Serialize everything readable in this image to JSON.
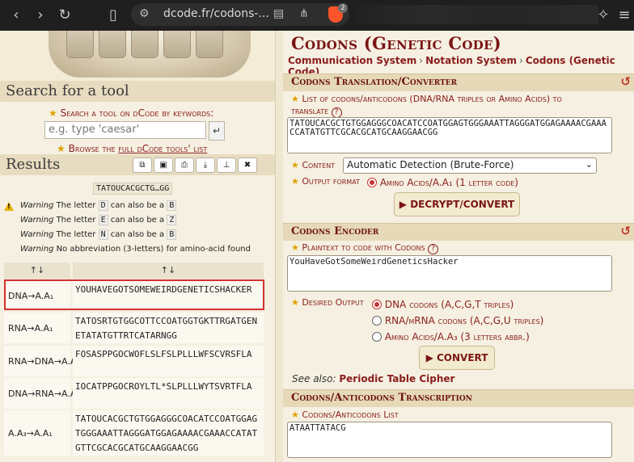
{
  "browser": {
    "url": "dcode.fr/codons-...",
    "brave_badge": "2"
  },
  "left": {
    "search_heading": "Search for a tool",
    "search_label": "Search a tool on dCode by keywords:",
    "search_placeholder": "e.g. type 'caesar'",
    "browse_prefix": "Browse the ",
    "browse_link": "full dCode tools' list",
    "results_title": "Results",
    "input_tag": "TATOUCACGCTG…GG",
    "warnings": [
      {
        "pre": "Warning",
        "text1": " The letter ",
        "key": "D",
        "text2": " can also be a ",
        "key2": "B"
      },
      {
        "pre": "Warning",
        "text1": " The letter ",
        "key": "E",
        "text2": " can also be a ",
        "key2": "Z"
      },
      {
        "pre": "Warning",
        "text1": " The letter ",
        "key": "N",
        "text2": " can also be a ",
        "key2": "B"
      },
      {
        "pre": "Warning",
        "text1": " No abbreviation (3-letters) for amino-acid found",
        "key": "",
        "text2": "",
        "key2": ""
      }
    ],
    "table": {
      "sort_col1": "↑↓",
      "sort_col2": "↑↓",
      "rows": [
        {
          "key": "DNA→A.A₁",
          "value": "YOUHAVEGOTSOMEWEIRDGENETICSHACKER"
        },
        {
          "key": "RNA→A.A₁",
          "value": "TATOSRTGTGGCOTTCCOATGGTGKTTRGATGENETATATGTTRTCATARNGG"
        },
        {
          "key": "RNA→DNA→A.A₁",
          "value": "FOSASPPGOCWOFLSLFSLPLLLWFSCVRSFLA"
        },
        {
          "key": "DNA→RNA→A.A₁",
          "value": "IOCATPPGOCROYLTL*SLPLLLWYTSVRTFLA"
        },
        {
          "key": "A.A₃→A.A₁",
          "value": "TATOUCACGCTGTGGAGGGCOACATCCOATGGAGTGGGAAATTAGGGATGGAGAAAACGAAACCATATGTTCGCACGCATGCAAGGAACGG"
        }
      ]
    }
  },
  "right": {
    "page_title": "Codons (Genetic Code)",
    "breadcrumbs": [
      "Communication System",
      "Notation System",
      "Codons (Genetic Code)"
    ],
    "translator": {
      "title": "Codons Translation/Converter",
      "list_label": "List of codons/anticodons (DNA/RNA triples or Amino Acids) to translate",
      "list_value": "TATOUCACGCTGTGGAGGGCOACATCCOATGGAGTGGGAAATTAGGGATGGAGAAAACGAAACCATATGTTCGCACGCATGCAAGGAACGG",
      "content_label": "Content",
      "content_value": "Automatic Detection (Brute-Force)",
      "output_label": "Output format",
      "output_option": "Amino Acids/A.A₁ (1 letter code)",
      "button": "▶ DECRYPT/CONVERT"
    },
    "encoder": {
      "title": "Codons Encoder",
      "plaintext_label": "Plaintext to code with Codons",
      "plaintext_value": "YouHaveGotSomeWeirdGeneticsHacker",
      "desired_label": "Desired Output",
      "options": [
        "DNA codons (A,C,G,T triples)",
        "RNA/mRNA codons (A,C,G,U triples)",
        "Amino Acids/A.A₃ (3 letters abbr.)"
      ],
      "button": "▶ CONVERT",
      "see_also_label": "See also:",
      "see_also_link": "Periodic Table Cipher"
    },
    "transcription": {
      "title": "Codons/Anticodons Transcription",
      "list_label": "Codons/Anticodons List",
      "list_value": "ATAATTATACG"
    }
  }
}
